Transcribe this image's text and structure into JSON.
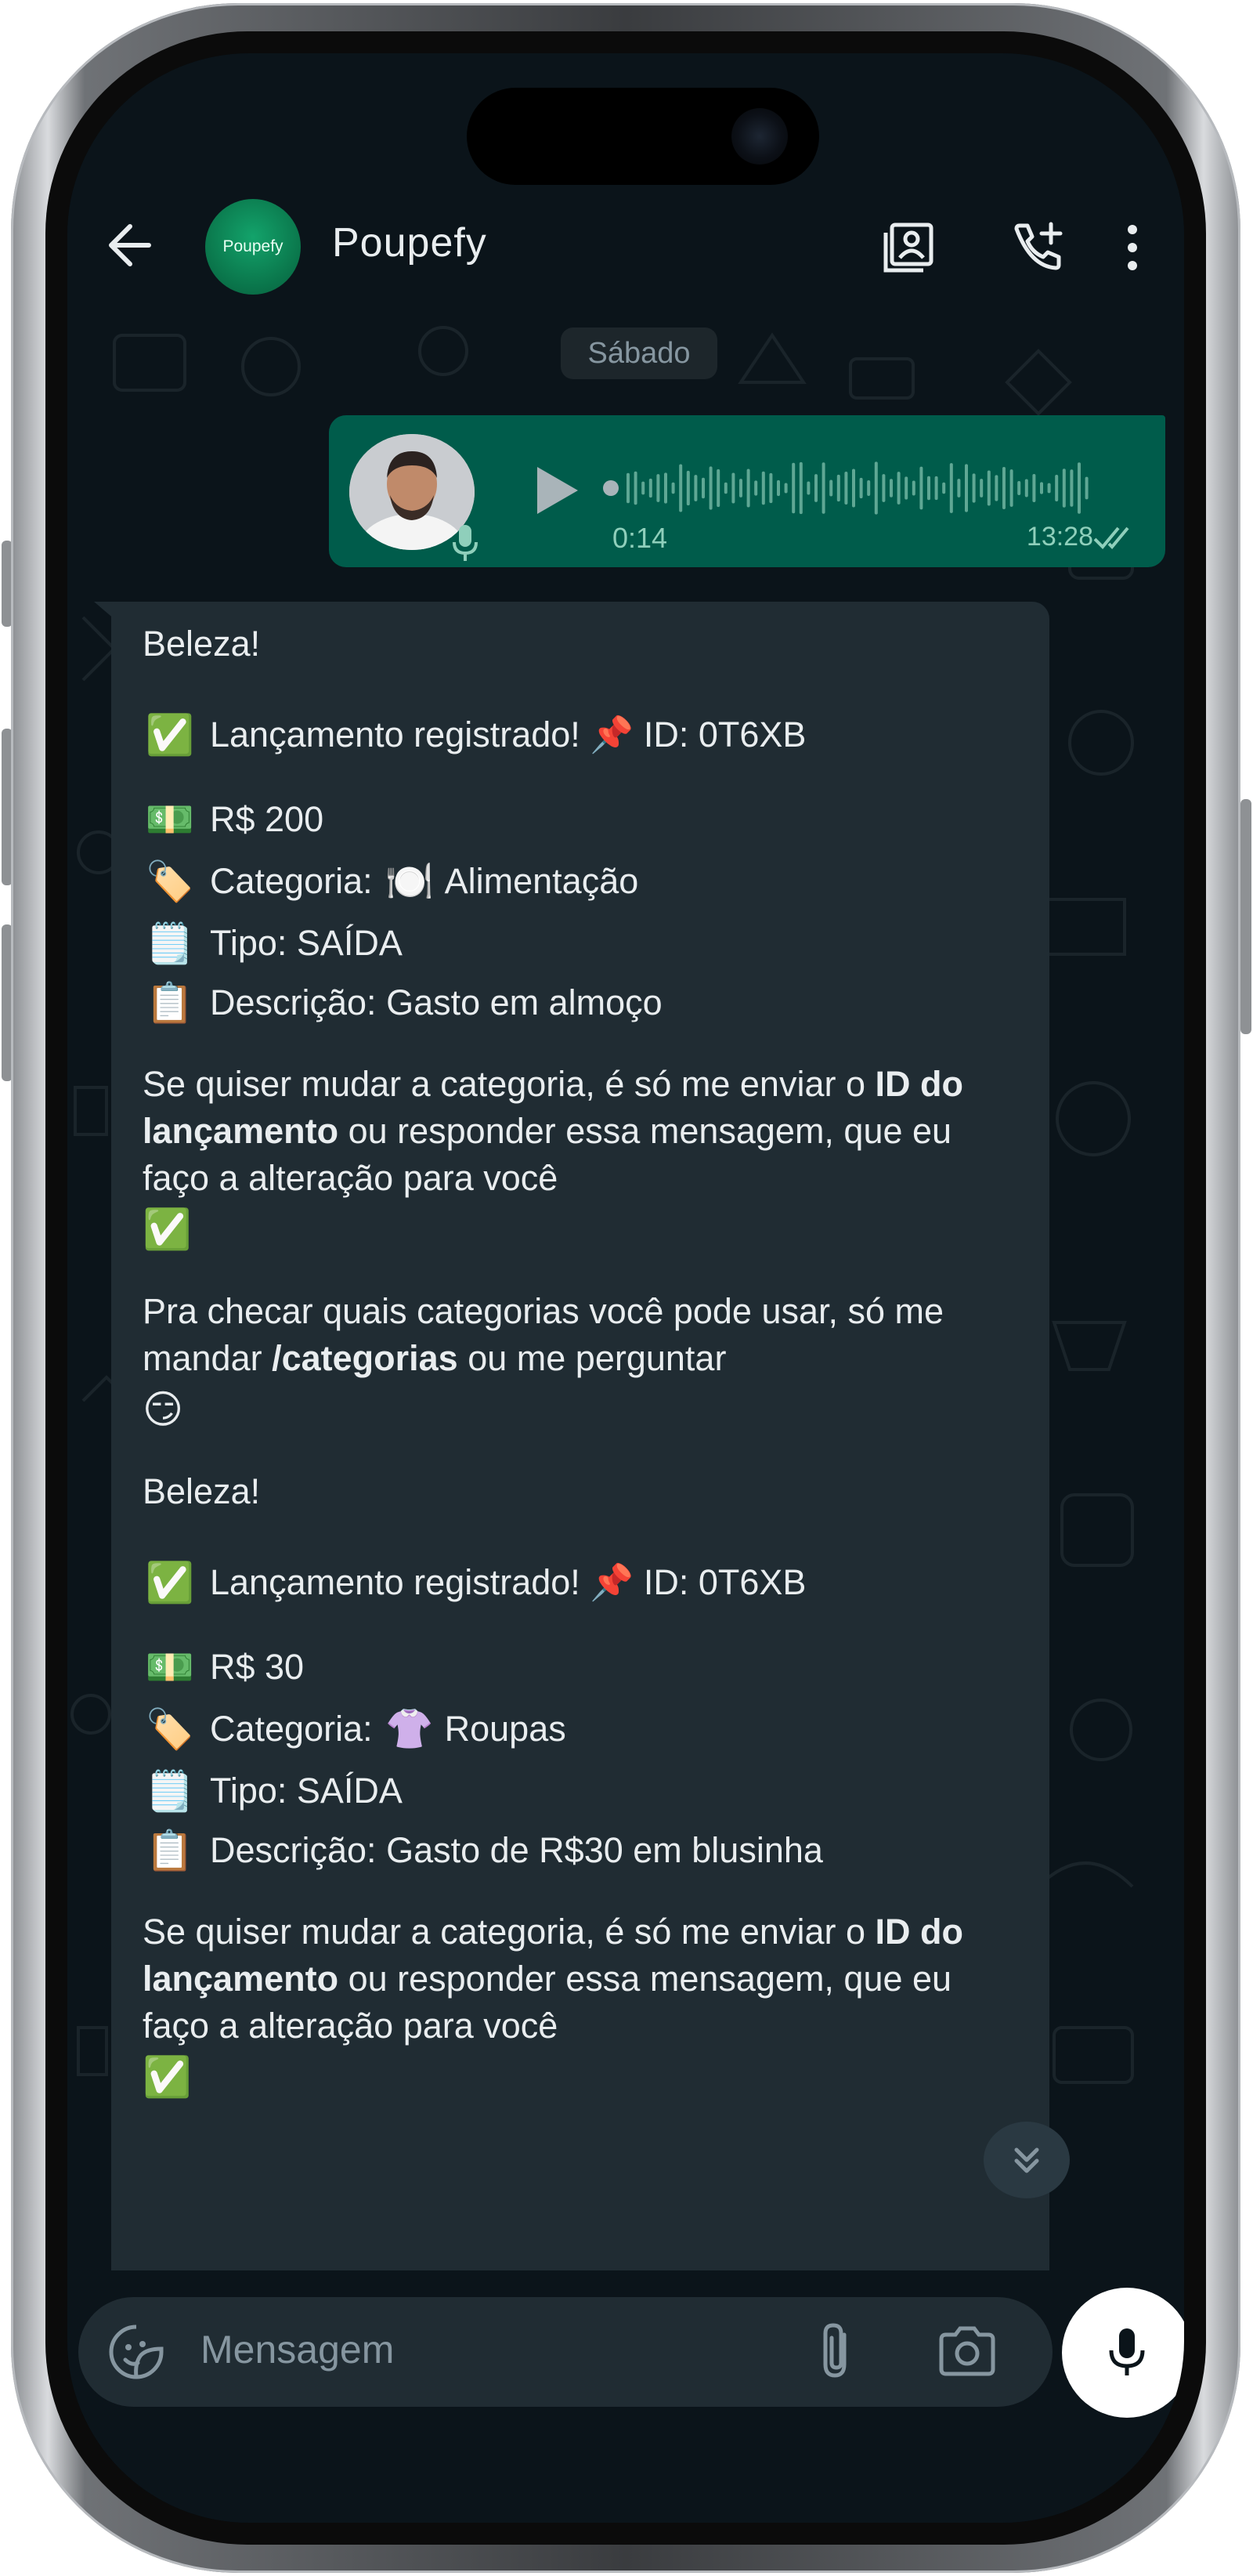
{
  "header": {
    "contact_name": "Poupefy",
    "avatar_text": "Poupefy"
  },
  "chat": {
    "date_label": "Sábado",
    "voice_message": {
      "duration": "0:14",
      "time": "13:28"
    },
    "messages": [
      {
        "greeting": "Beleza!",
        "registered": "Lançamento registrado! 📌 ID: 0T6XB",
        "amount": "R$ 200",
        "category_prefix": "Categoria:",
        "category_emoji": "🍽️",
        "category_name": "Alimentação",
        "type": "Tipo: SAÍDA",
        "description": "Descrição: Gasto em almoço",
        "change_text_1": "Se quiser mudar a categoria, é só me enviar o ",
        "change_bold": "ID do lançamento",
        "change_text_2": " ou responder essa mensagem, que eu faço a alteração para você",
        "check_text_1": "Pra checar quais categorias você pode usar, só me mandar ",
        "check_bold": "/categorias",
        "check_text_2": " ou me perguntar"
      },
      {
        "greeting": "Beleza!",
        "registered": "Lançamento registrado! 📌 ID: 0T6XB",
        "amount": "R$ 30",
        "category_prefix": "Categoria:",
        "category_emoji": "👚",
        "category_name": "Roupas",
        "type": "Tipo: SAÍDA",
        "description": "Descrição: Gasto de R$30 em blusinha",
        "change_text_1": "Se quiser mudar a categoria, é só me enviar o ",
        "change_bold": "ID do lançamento",
        "change_text_2": " ou responder essa mensagem, que eu faço a alteração para você"
      }
    ]
  },
  "input": {
    "placeholder": "Mensagem"
  },
  "colors": {
    "background": "#0b141a",
    "outgoing_bubble": "#005c4b",
    "incoming_bubble": "#202c33",
    "text": "#e9edef",
    "muted": "#8696a0"
  },
  "icons": {
    "back": "arrow-left-icon",
    "contact_card": "contact-card-icon",
    "add_call": "phone-plus-icon",
    "menu": "kebab-menu-icon",
    "sticker": "sticker-icon",
    "attach": "paperclip-icon",
    "camera": "camera-icon",
    "mic": "microphone-icon",
    "scroll_down": "double-chevron-down-icon"
  }
}
